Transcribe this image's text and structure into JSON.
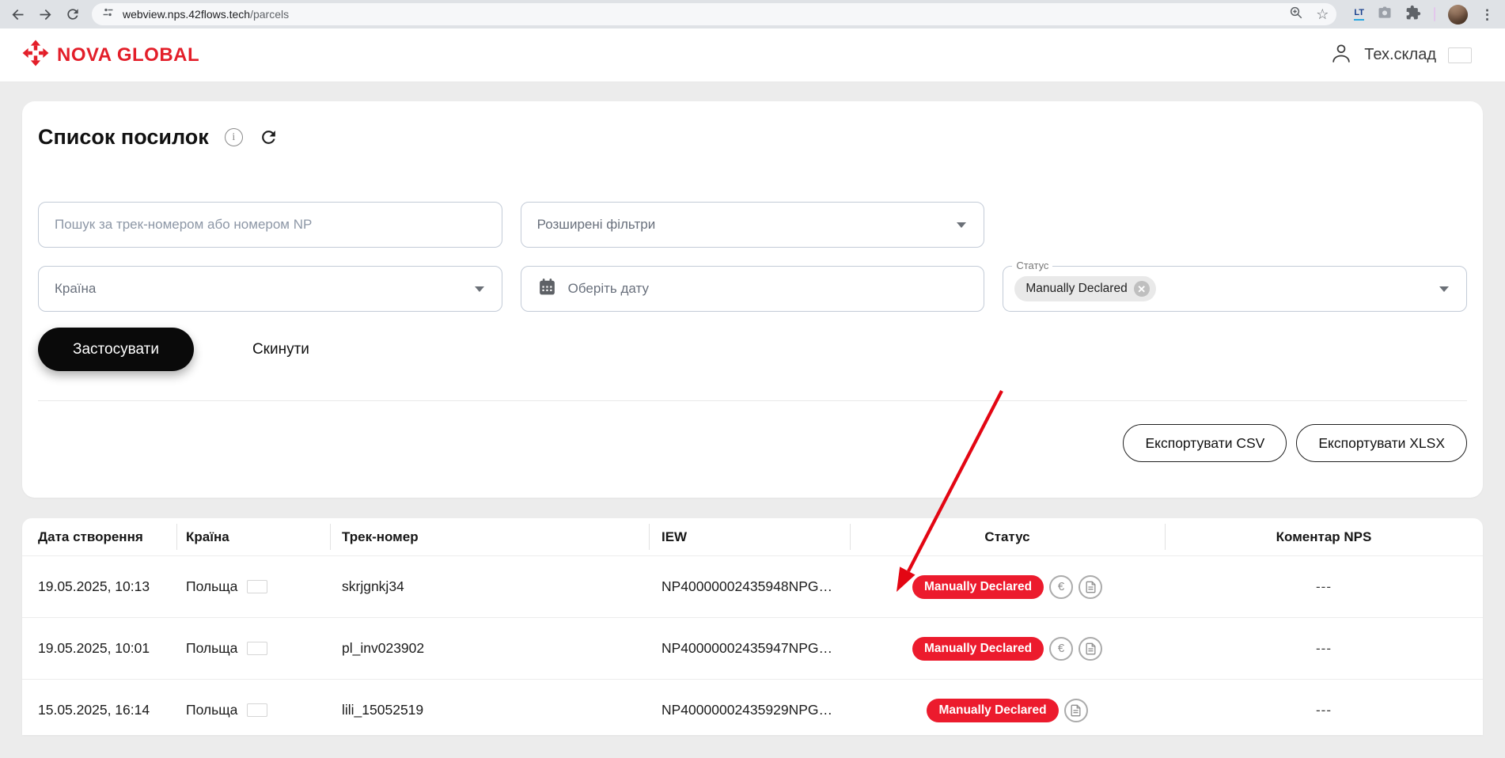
{
  "browser": {
    "url_host": "webview.nps.42flows.tech",
    "url_path": "/parcels"
  },
  "app_header": {
    "brand": "NOVA GLOBAL",
    "user_name": "Тех.склад"
  },
  "page": {
    "title": "Список посилок"
  },
  "filters": {
    "search_placeholder": "Пошук за трек-номером або номером NP",
    "advanced_label": "Розширені фільтри",
    "country_placeholder": "Країна",
    "date_placeholder": "Оберіть дату",
    "status_label": "Статус",
    "status_chip": "Manually Declared",
    "apply": "Застосувати",
    "reset": "Скинути"
  },
  "export": {
    "csv": "Експортувати CSV",
    "xlsx": "Експортувати XLSX"
  },
  "table": {
    "columns": [
      "Дата створення",
      "Країна",
      "Трек-номер",
      "IEW",
      "Статус",
      "Коментар NPS"
    ],
    "rows": [
      {
        "date": "19.05.2025, 10:13",
        "country": "Польща",
        "track": "skrjgnkj34",
        "iew": "NP40000002435948NPG…",
        "status": "Manually Declared",
        "has_euro": true,
        "has_doc": true,
        "comment": "---"
      },
      {
        "date": "19.05.2025, 10:01",
        "country": "Польща",
        "track": "pl_inv023902",
        "iew": "NP40000002435947NPG…",
        "status": "Manually Declared",
        "has_euro": true,
        "has_doc": true,
        "comment": "---"
      },
      {
        "date": "15.05.2025, 16:14",
        "country": "Польща",
        "track": "lili_15052519",
        "iew": "NP40000002435929NPG…",
        "status": "Manually Declared",
        "has_euro": false,
        "has_doc": true,
        "comment": "---"
      }
    ]
  },
  "icons": {
    "star": "☆",
    "euro": "€",
    "menu_dots": "⋮",
    "lt_badge": "LT",
    "info": "i"
  },
  "colors": {
    "brand_red": "#E31E29",
    "badge_red": "#EC1B2D",
    "flag_red": "#D81A3C",
    "annotation_red": "#E30613",
    "page_bg": "#ECECEC"
  }
}
